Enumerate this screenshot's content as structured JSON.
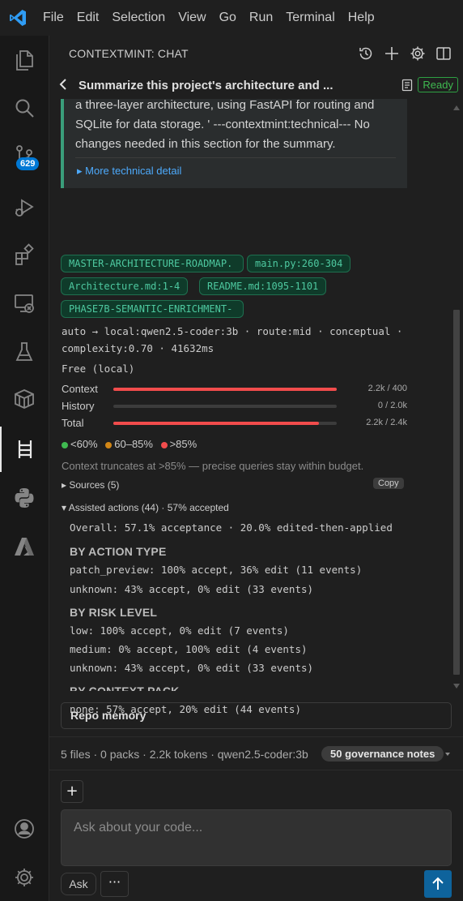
{
  "menu": [
    "File",
    "Edit",
    "Selection",
    "View",
    "Go",
    "Run",
    "Terminal",
    "Help"
  ],
  "activity": {
    "scm_badge": "629"
  },
  "panel": {
    "title": "CONTEXTMINT: CHAT"
  },
  "chat": {
    "title": "Summarize this project's architecture and ...",
    "status": "Ready",
    "quote_text": "a three-layer architecture, using FastAPI for routing and SQLite for data storage. ' ---contextmint:technical--- No changes needed in this section for the summary.",
    "more_detail": "▸ More technical detail",
    "sources_chips": [
      "MASTER-ARCHITECTURE-ROADMAP.",
      "main.py:260-304",
      "Architecture.md:1-4",
      "README.md:1095-1101",
      "PHASE7B-SEMANTIC-ENRICHMENT-"
    ],
    "route_line1": "auto → local:qwen2.5-coder:3b · route:mid · conceptual ·",
    "route_line2": "complexity:0.70 · 41632ms",
    "tier": "Free (local)"
  },
  "budget": {
    "bars": [
      {
        "label": "Context",
        "value": "2.2k / 400",
        "fill": 1.0
      },
      {
        "label": "History",
        "value": "0 / 2.0k",
        "fill": 0.0
      },
      {
        "label": "Total",
        "value": "2.2k / 2.4k",
        "fill": 0.92
      }
    ],
    "legend": [
      {
        "label": "<60%",
        "color": "#3fb950"
      },
      {
        "label": "60–85%",
        "color": "#d18616"
      },
      {
        "label": ">85%",
        "color": "#f14c4c"
      }
    ],
    "note": "Context truncates at >85% — precise queries stay within budget."
  },
  "sources_toggle": "▸ Sources (5)",
  "copy_label": "Copy",
  "assisted": {
    "toggle": "▾ Assisted actions (44) · 57% accepted",
    "overall": "Overall: 57.1% acceptance · 20.0% edited-then-applied",
    "sections": [
      {
        "heading": "BY ACTION TYPE",
        "lines": [
          "patch_preview: 100% accept, 36% edit (11 events)",
          "unknown: 43% accept, 0% edit (33 events)"
        ]
      },
      {
        "heading": "BY RISK LEVEL",
        "lines": [
          "low: 100% accept, 0% edit (7 events)",
          "medium: 0% accept, 100% edit (4 events)",
          "unknown: 43% accept, 0% edit (33 events)"
        ]
      },
      {
        "heading": "BY CONTEXT PACK",
        "lines": [
          "none: 57% accept, 20% edit (44 events)"
        ]
      }
    ]
  },
  "repo_memory": "Repo memory",
  "status_line": "5 files · 0 packs · 2.2k tokens · qwen2.5-coder:3b",
  "governance": "50 governance notes",
  "input": {
    "placeholder": "Ask about your code...",
    "mode": "Ask",
    "more": "···",
    "plus": "+"
  }
}
